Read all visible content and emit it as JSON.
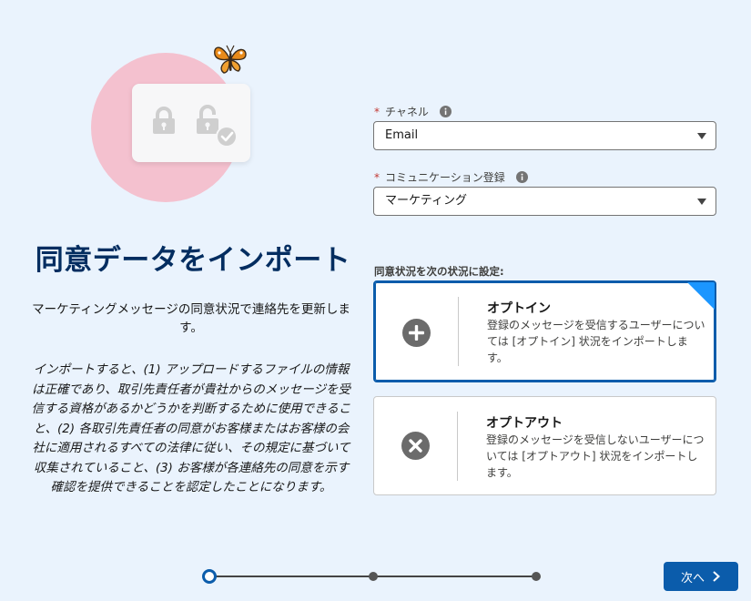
{
  "title": "同意データをインポート",
  "description": "マーケティングメッセージの同意状況で連絡先を更新します。",
  "legal": "インポートすると、(1) アップロードするファイルの情報は正確であり、取引先責任者が貴社からのメッセージを受信する資格があるかどうかを判断するために使用できること、(2) 各取引先責任者の同意がお客様またはお客様の会社に適用されるすべての法律に従い、その規定に基づいて収集されていること、(3) お客様が各連絡先の同意を示す確認を提供できることを認定したことになります。",
  "channel": {
    "required_mark": "*",
    "label": "チャネル",
    "value": "Email",
    "info_icon": "info-icon"
  },
  "subscription": {
    "required_mark": "*",
    "label": "コミュニケーション登録",
    "value": "マーケティング",
    "info_icon": "info-icon"
  },
  "consent_section_label": "同意状況を次の状況に設定:",
  "options": [
    {
      "title": "オプトイン",
      "description": "登録のメッセージを受信するユーザーについては [オプトイン] 状況をインポートします。",
      "icon": "plus-circle-icon",
      "selected": true
    },
    {
      "title": "オプトアウト",
      "description": "登録のメッセージを受信しないユーザーについては [オプトアウト] 状況をインポートします。",
      "icon": "x-circle-icon",
      "selected": false
    }
  ],
  "progress": {
    "steps": 3,
    "current": 1
  },
  "next_button": {
    "label": "次へ",
    "icon": "chevron-right-icon"
  },
  "colors": {
    "accent": "#0b5cab",
    "title": "#032d60",
    "background": "#eaf3fd",
    "illustration_circle": "#f4c1cf",
    "selected_corner": "#1b96ff"
  }
}
